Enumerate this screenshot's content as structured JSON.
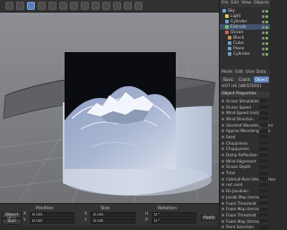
{
  "colors": {
    "accent": "#5a7fb5",
    "selection": "#41546e",
    "ocean": "#b3c0d6"
  },
  "object_manager": {
    "menu": [
      "File",
      "Edit",
      "View",
      "Objects"
    ],
    "items": [
      {
        "label": "Sky",
        "icon_color": "#6fa0d8"
      },
      {
        "label": "Light",
        "icon_color": "#e0d060"
      },
      {
        "label": "Cylinder",
        "icon_color": "#70a0d0"
      },
      {
        "label": "Extrude",
        "icon_color": "#70c070",
        "selected": true
      },
      {
        "label": "Ocean",
        "icon_color": "#d06060"
      },
      {
        "label": "Block",
        "icon_color": "#d09050"
      },
      {
        "label": "Cube",
        "icon_color": "#70a0d0"
      },
      {
        "label": "Plane",
        "icon_color": "#70a0d0"
      },
      {
        "label": "Cylinder",
        "icon_color": "#70a0d0"
      }
    ]
  },
  "attributes": {
    "menu": [
      "Mode",
      "Edit",
      "User Data"
    ],
    "tabs": [
      "Basic",
      "Coord.",
      "Object"
    ],
    "object_label": "HOT HS [WESTERS]",
    "properties_title": "Object Properties",
    "properties": [
      "Ocean Simulation",
      "Ocean Speed",
      "Wind Speed (m/s)",
      "Wind Direction",
      "Shortest Wavelength (m)",
      "Approx Wavelength (m)",
      "Seed",
      "Choppiness",
      "Choppyness",
      "Damp Reflection",
      "Wind Alignment",
      "Ocean Depth",
      "Time",
      "Catmull-Rom Interpolation",
      "not used",
      "Do Jacobian",
      "Jacobi Map (terrasse)",
      "Foam Threshold",
      "Foam Map (terrasse)",
      "Foam Threshold",
      "Foam Map (terrasse)",
      "Point Selection"
    ]
  },
  "coordinates": {
    "headers": [
      "Position",
      "Size",
      "Rotation"
    ],
    "rows": [
      {
        "axis": "X",
        "position": "0 cm",
        "size": "0 cm",
        "rotation_label": "H",
        "rotation": "0 °"
      },
      {
        "axis": "Y",
        "position": "0 cm",
        "size": "0 cm",
        "rotation_label": "P",
        "rotation": "0 °"
      }
    ],
    "buttons": [
      "Object (Rel)",
      "Size",
      "Apply"
    ]
  }
}
